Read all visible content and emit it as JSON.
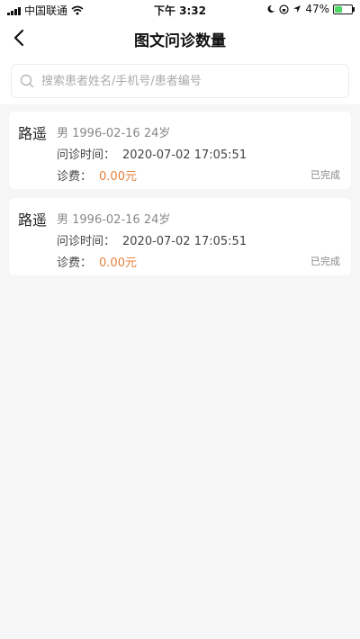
{
  "status_bar": {
    "carrier": "中国联通",
    "time": "下午 3:32",
    "battery_percent": "47%",
    "battery_level": 0.47,
    "battery_color": "#4cd964"
  },
  "nav": {
    "title": "图文问诊数量",
    "back_icon": "chevron-left-icon"
  },
  "search": {
    "placeholder": "搜索患者姓名/手机号/患者编号",
    "value": "",
    "icon": "search-icon"
  },
  "records": [
    {
      "name": "路遥",
      "info": "男 1996-02-16 24岁",
      "consult_label": "问诊时间：",
      "consult_time": "2020-07-02 17:05:51",
      "fee_label": "诊费：",
      "fee": "0.00元",
      "status": "已完成"
    },
    {
      "name": "路遥",
      "info": "男 1996-02-16 24岁",
      "consult_label": "问诊时间：",
      "consult_time": "2020-07-02 17:05:51",
      "fee_label": "诊费：",
      "fee": "0.00元",
      "status": "已完成"
    }
  ],
  "colors": {
    "fee_accent": "#e4813c",
    "page_background": "#f5f6f5"
  }
}
